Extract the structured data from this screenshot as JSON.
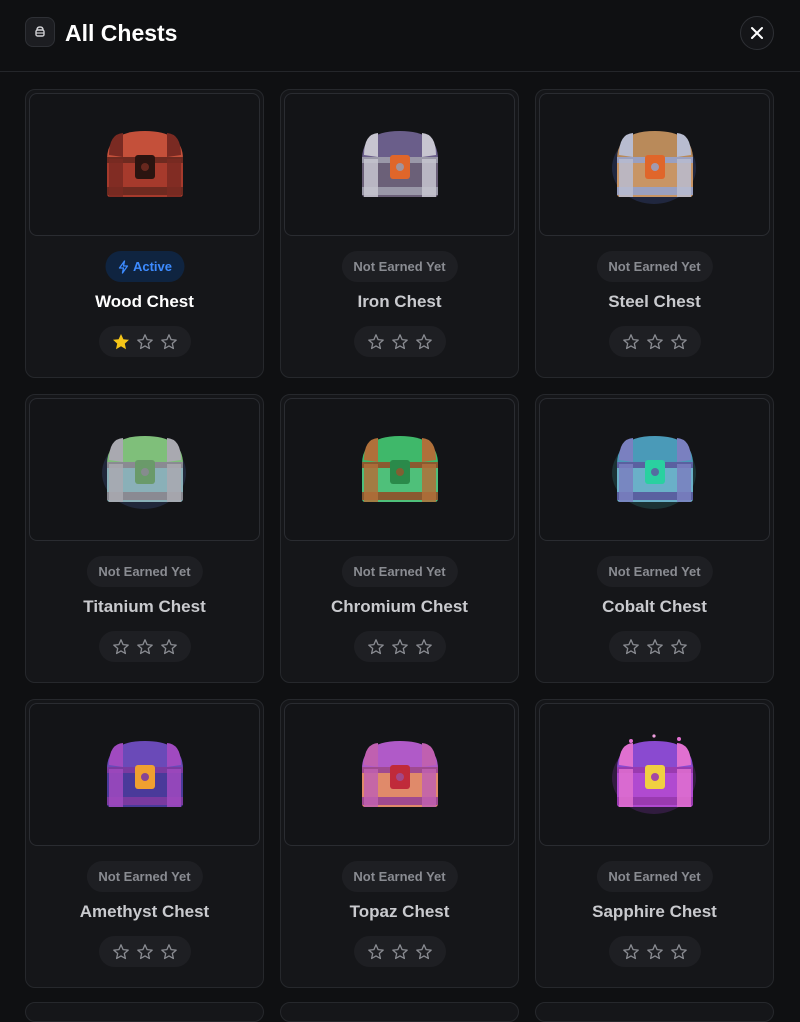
{
  "header": {
    "title": "All Chests",
    "icon": "chest-badge-icon",
    "close_icon": "close-icon"
  },
  "colors": {
    "background": "#0f1012",
    "card": "#151619",
    "active_accent": "#3d8bff",
    "star_filled": "#f5c518",
    "muted_text": "#8a8c92"
  },
  "chests": [
    {
      "name": "Wood Chest",
      "status": "Active",
      "status_icon": "lightning-icon",
      "stars_earned": 1,
      "stars_total": 3,
      "active": true
    },
    {
      "name": "Iron Chest",
      "status": "Not Earned Yet",
      "stars_earned": 0,
      "stars_total": 3,
      "active": false
    },
    {
      "name": "Steel Chest",
      "status": "Not Earned Yet",
      "stars_earned": 0,
      "stars_total": 3,
      "active": false
    },
    {
      "name": "Titanium Chest",
      "status": "Not Earned Yet",
      "stars_earned": 0,
      "stars_total": 3,
      "active": false
    },
    {
      "name": "Chromium Chest",
      "status": "Not Earned Yet",
      "stars_earned": 0,
      "stars_total": 3,
      "active": false
    },
    {
      "name": "Cobalt Chest",
      "status": "Not Earned Yet",
      "stars_earned": 0,
      "stars_total": 3,
      "active": false
    },
    {
      "name": "Amethyst Chest",
      "status": "Not Earned Yet",
      "stars_earned": 0,
      "stars_total": 3,
      "active": false
    },
    {
      "name": "Topaz Chest",
      "status": "Not Earned Yet",
      "stars_earned": 0,
      "stars_total": 3,
      "active": false
    },
    {
      "name": "Sapphire Chest",
      "status": "Not Earned Yet",
      "stars_earned": 0,
      "stars_total": 3,
      "active": false
    }
  ]
}
